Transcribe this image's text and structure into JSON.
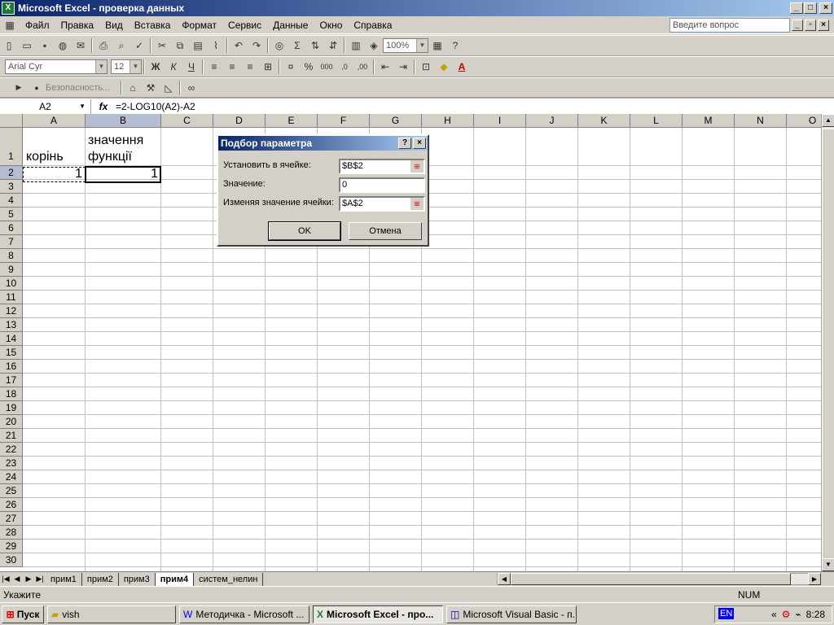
{
  "window": {
    "title": "Microsoft Excel - проверка данных",
    "minimize": "_",
    "maximize": "□",
    "close": "×"
  },
  "menu": {
    "items": [
      "Файл",
      "Правка",
      "Вид",
      "Вставка",
      "Формат",
      "Сервис",
      "Данные",
      "Окно",
      "Справка"
    ],
    "ask_placeholder": "Введите вопрос"
  },
  "toolbar_standard": {
    "zoom": "100%"
  },
  "toolbar_format": {
    "font": "Arial Cyr",
    "size": "12",
    "bold": "Ж",
    "italic": "К",
    "underline": "Ч"
  },
  "toolbar_security": {
    "label": "Безопасность..."
  },
  "formula_bar": {
    "name_box": "A2",
    "fx": "fx",
    "formula": "=2-LOG10(A2)-A2"
  },
  "columns": [
    "A",
    "B",
    "C",
    "D",
    "E",
    "F",
    "G",
    "H",
    "I",
    "J",
    "K",
    "L",
    "M",
    "N",
    "O"
  ],
  "rows": [
    "1",
    "2",
    "3",
    "4",
    "5",
    "6",
    "7",
    "8",
    "9",
    "10",
    "11",
    "12",
    "13",
    "14",
    "15",
    "16",
    "17",
    "18",
    "19",
    "20",
    "21",
    "22",
    "23",
    "24",
    "25",
    "26",
    "27",
    "28",
    "29",
    "30"
  ],
  "cells": {
    "A1": "корінь",
    "B1_line1": "значення",
    "B1_line2": "функції",
    "A2": "1",
    "B2": "1"
  },
  "sheet_tabs": [
    "прим1",
    "прим2",
    "прим3",
    "прим4",
    "систем_нелин"
  ],
  "active_sheet": "прим4",
  "status": {
    "left": "Укажите",
    "num": "NUM"
  },
  "dialog": {
    "title": "Подбор параметра",
    "help": "?",
    "close": "×",
    "set_cell_label": "Установить в ячейке:",
    "set_cell_value": "$B$2",
    "value_label": "Значение:",
    "value_value": "0",
    "changing_label": "Изменяя значение ячейки:",
    "changing_value": "$A$2",
    "ok": "OK",
    "cancel": "Отмена"
  },
  "taskbar": {
    "start": "Пуск",
    "buttons": [
      "vish",
      "Методичка - Microsoft ...",
      "Microsoft Excel - про...",
      "Microsoft Visual Basic - п..."
    ],
    "lang": "EN",
    "clock": "8:28"
  }
}
